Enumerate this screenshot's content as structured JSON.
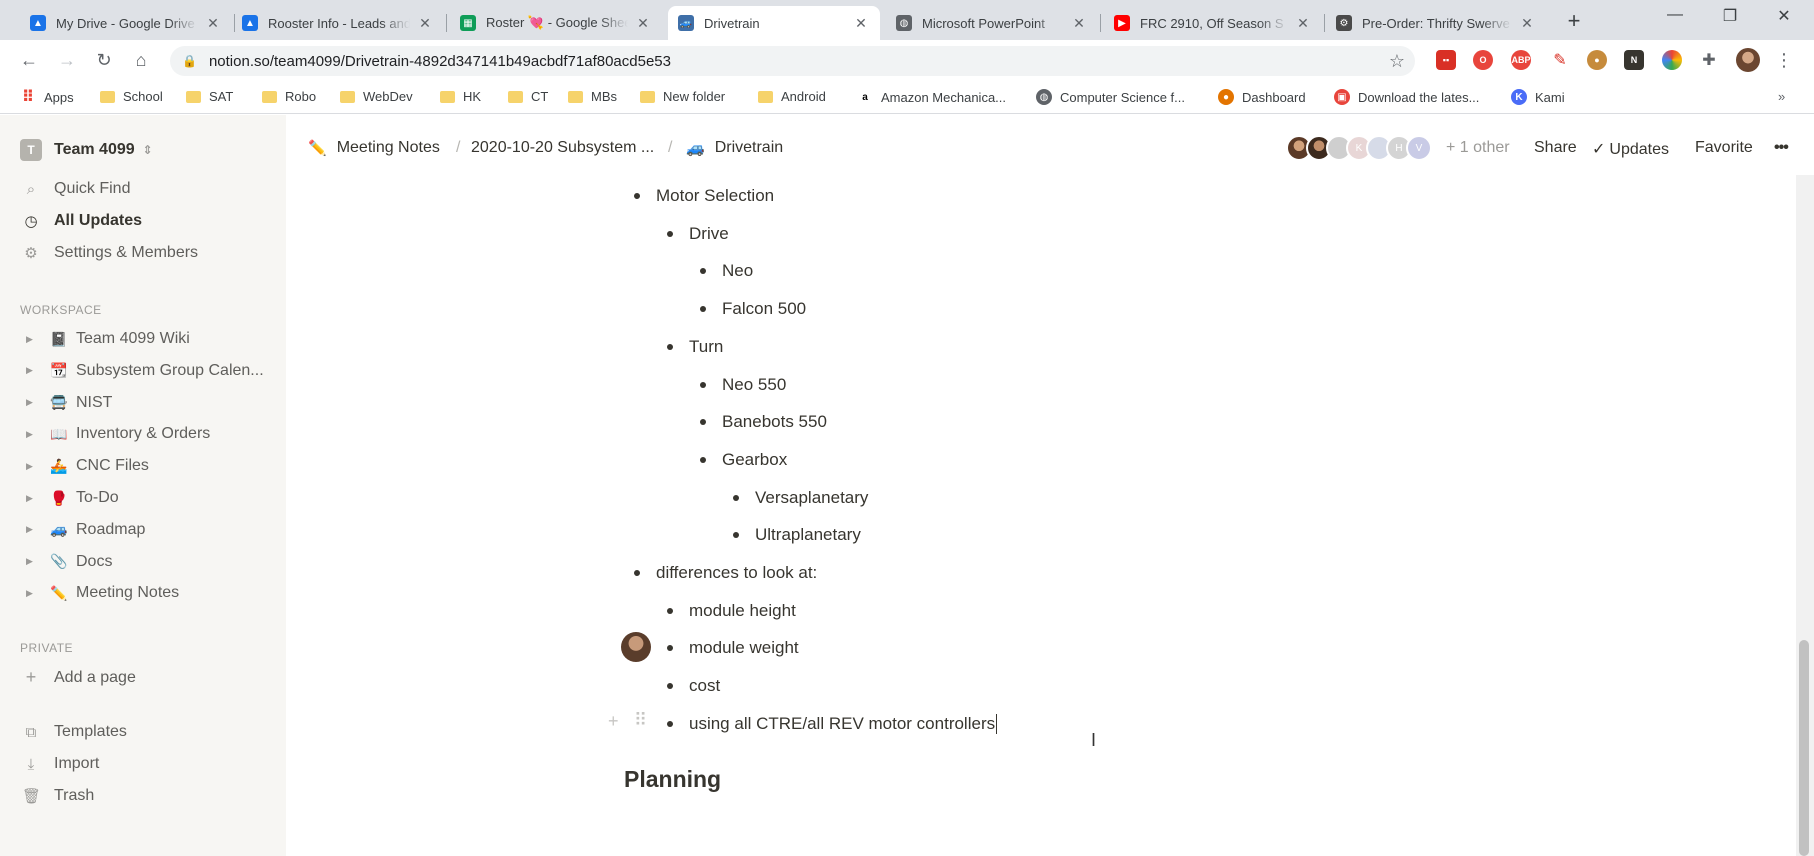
{
  "tabs": [
    {
      "title": "My Drive - Google Drive",
      "icon": "google-drive-icon",
      "color": "#1a73e8"
    },
    {
      "title": "Rooster Info - Leads and",
      "icon": "google-drive-icon",
      "color": "#1a73e8"
    },
    {
      "title": "Roster 💘 - Google Sheets",
      "icon": "google-sheets-icon",
      "color": "#0f9d58"
    },
    {
      "title": "Drivetrain",
      "icon": "car-icon",
      "color": "#3f6fa8"
    },
    {
      "title": "Microsoft PowerPoint",
      "icon": "globe-icon",
      "color": "#5f6368"
    },
    {
      "title": "FRC 2910, Off Season S",
      "icon": "youtube-icon",
      "color": "#ff0000"
    },
    {
      "title": "Pre-Order: Thrifty Swerve",
      "icon": "robot-icon",
      "color": "#4a4a4a"
    }
  ],
  "address_bar": {
    "url": "notion.so/team4099/Drivetrain-4892d347141b49acbdf71af80acd5e53"
  },
  "bookmarks": [
    {
      "label": "Apps",
      "kind": "apps"
    },
    {
      "label": "School",
      "kind": "folder"
    },
    {
      "label": "SAT",
      "kind": "folder"
    },
    {
      "label": "Robo",
      "kind": "folder"
    },
    {
      "label": "WebDev",
      "kind": "folder"
    },
    {
      "label": "HK",
      "kind": "folder"
    },
    {
      "label": "CT",
      "kind": "folder"
    },
    {
      "label": "MBs",
      "kind": "folder"
    },
    {
      "label": "New folder",
      "kind": "folder"
    },
    {
      "label": "Android",
      "kind": "folder"
    },
    {
      "label": "Amazon Mechanica...",
      "kind": "amazon"
    },
    {
      "label": "Computer Science f...",
      "kind": "globe"
    },
    {
      "label": "Dashboard",
      "kind": "dashboard"
    },
    {
      "label": "Download the lates...",
      "kind": "download"
    },
    {
      "label": "Kami",
      "kind": "kami"
    }
  ],
  "sidebar": {
    "workspace": {
      "badge": "T",
      "name": "Team 4099"
    },
    "nav": [
      {
        "label": "Quick Find",
        "icon": "search-icon"
      },
      {
        "label": "All Updates",
        "icon": "clock-icon"
      },
      {
        "label": "Settings & Members",
        "icon": "gear-icon"
      }
    ],
    "workspace_label": "WORKSPACE",
    "pages": [
      {
        "label": "Team 4099 Wiki",
        "emoji": "📓"
      },
      {
        "label": "Subsystem Group Calen...",
        "emoji": "📆"
      },
      {
        "label": "NIST",
        "emoji": "🚍"
      },
      {
        "label": "Inventory & Orders",
        "emoji": "📖"
      },
      {
        "label": "CNC Files",
        "emoji": "🚣"
      },
      {
        "label": "To-Do",
        "emoji": "🥊"
      },
      {
        "label": "Roadmap",
        "emoji": "🚙"
      },
      {
        "label": "Docs",
        "emoji": "📎"
      },
      {
        "label": "Meeting Notes",
        "emoji": "✏️"
      }
    ],
    "private_label": "PRIVATE",
    "add_page": "Add a page",
    "footer": [
      {
        "label": "Templates",
        "icon": "templates-icon"
      },
      {
        "label": "Import",
        "icon": "import-icon"
      },
      {
        "label": "Trash",
        "icon": "trash-icon"
      }
    ]
  },
  "topbar": {
    "breadcrumbs": [
      {
        "label": "Meeting Notes",
        "emoji": "✏️"
      },
      {
        "label": "2020-10-20 Subsystem ...",
        "emoji": ""
      },
      {
        "label": "Drivetrain",
        "emoji": "🚙"
      }
    ],
    "others": "+ 1 other",
    "share": "Share",
    "updates": "Updates",
    "favorite": "Favorite",
    "more": "•••"
  },
  "content": {
    "bullets": [
      {
        "text": "Motor Selection",
        "level": 0
      },
      {
        "text": "Drive",
        "level": 1
      },
      {
        "text": "Neo",
        "level": 2
      },
      {
        "text": "Falcon 500",
        "level": 2
      },
      {
        "text": "Turn",
        "level": 1
      },
      {
        "text": "Neo 550",
        "level": 2
      },
      {
        "text": "Banebots 550",
        "level": 2
      },
      {
        "text": "Gearbox",
        "level": 2
      },
      {
        "text": "Versaplanetary",
        "level": 3
      },
      {
        "text": "Ultraplanetary",
        "level": 3
      },
      {
        "text": "differences to look at:",
        "level": 0
      },
      {
        "text": "module height",
        "level": 1
      },
      {
        "text": "module weight",
        "level": 1
      },
      {
        "text": "cost",
        "level": 1
      },
      {
        "text": "using all CTRE/all REV motor controllers",
        "level": 1
      }
    ],
    "heading": "Planning"
  }
}
